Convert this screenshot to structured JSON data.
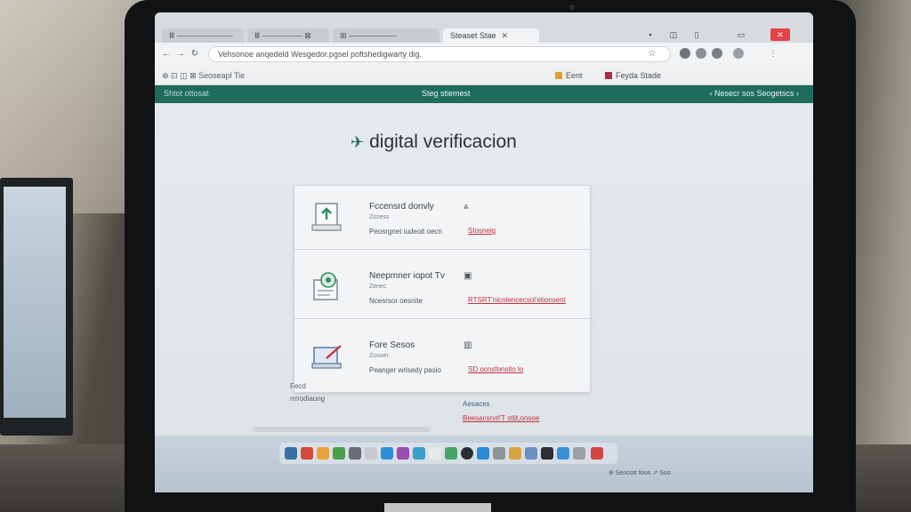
{
  "browser": {
    "tabs": [
      {
        "label": "Ⅲ ———————",
        "active": false
      },
      {
        "label": "Ⅲ ————— ⊠",
        "active": false
      },
      {
        "label": "⊞ ——————",
        "active": false
      },
      {
        "label": "Steaset Stae",
        "active": true
      }
    ],
    "address": "Vehsonoe anqedeld Wesgedor.pgsel poftshedigwarty dig.",
    "bookmarks": [
      {
        "label": "Eent",
        "color": "#e0a21d"
      },
      {
        "label": "Feyda Stade",
        "color": "#b02a44"
      }
    ],
    "bookmarks_left": "⊕ ⊡ ◫ ⊠ Seoseapl Tie"
  },
  "app": {
    "header_left": "Shtot ottosat",
    "header_center": "Steg stiemest",
    "header_right": "‹ Nesecr sos   Seogetscs ›"
  },
  "page": {
    "brand": "digital verificacion",
    "rows": [
      {
        "title": "Fccensrd donvly",
        "sub": "Zozess",
        "meta": "Peosrgnet iudeoit oecn",
        "state": "⩓",
        "link": "Stosneig"
      },
      {
        "title": "Neepmner iopot Tv",
        "sub": "Zenec",
        "meta": "Ncesrsor oesnite",
        "state": "▣",
        "link": "RTSRT'nicnlencecsol'etionsent"
      },
      {
        "title": "Fore Sesos",
        "sub": "Zosoer",
        "meta": "Peanger wrlsedy pasio",
        "state": "▥",
        "link": "SD ocnsfonsito lo"
      }
    ],
    "aside_label": "Fecd",
    "aside_status": "rrrrodiaung",
    "actions_label": "Aesaces",
    "actions_link": "Beesacsrvrl'T stlit,onsoe"
  },
  "taskbar": {
    "tray": "⊕ Sencotr foon   ↗ Soo"
  },
  "colors": {
    "accent": "#1f6c5f",
    "link_red": "#c0303b",
    "close_red": "#e2434b"
  }
}
